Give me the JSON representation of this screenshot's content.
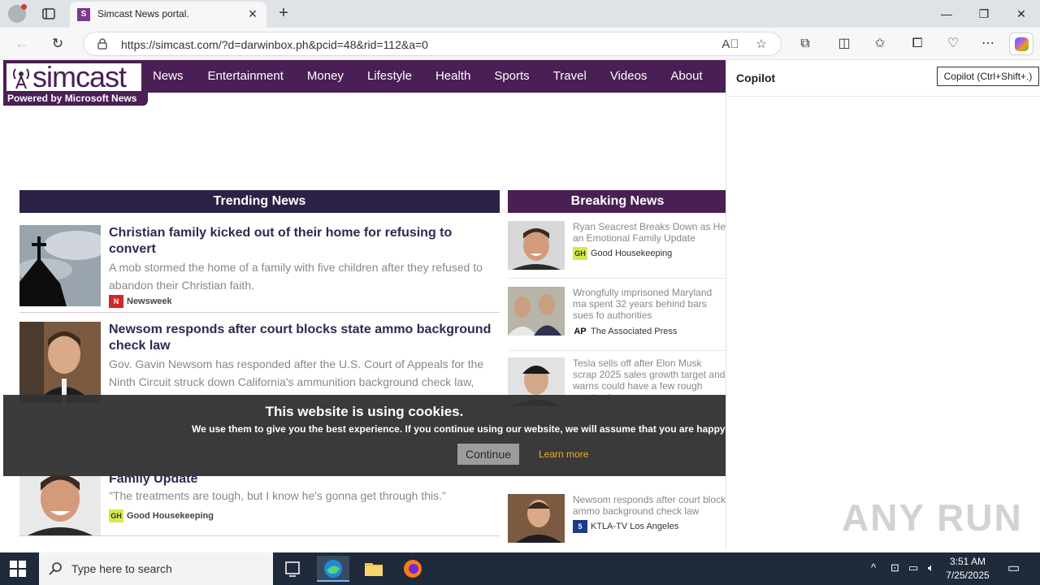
{
  "browser": {
    "tab_title": "Simcast News portal.",
    "url": "https://simcast.com/?d=darwinbox.ph&pcid=48&rid=112&a=0",
    "tooltip": "Copilot (Ctrl+Shift+.)"
  },
  "site": {
    "logo_text": "simcast",
    "logo_sub": "Powered by Microsoft News",
    "nav": [
      "News",
      "Entertainment",
      "Money",
      "Lifestyle",
      "Health",
      "Sports",
      "Travel",
      "Videos",
      "About Us"
    ],
    "trending_header": "Trending News",
    "breaking_header": "Breaking News"
  },
  "trending": [
    {
      "title": "Christian family kicked out of their home for refusing to convert",
      "desc": "A mob stormed the home of a family with five children after they refused to abandon their Christian faith.",
      "source": "Newsweek",
      "source_icon": "N"
    },
    {
      "title": "Newsom responds after court blocks state ammo background check law",
      "desc": "Gov. Gavin Newsom has responded after the U.S. Court of Appeals for the Ninth Circuit struck down California's ammunition background check law,",
      "source": "",
      "source_icon": ""
    },
    {
      "title": "Family Update",
      "desc": "\"The treatments are tough, but I know he's gonna get through this.\"",
      "source": "Good Housekeeping",
      "source_icon": "GH"
    }
  ],
  "breaking": [
    {
      "title": "Ryan Seacrest Breaks Down as He an Emotional Family Update",
      "source": "Good Housekeeping",
      "source_icon": "GH"
    },
    {
      "title": "Wrongfully imprisoned Maryland ma spent 32 years behind bars sues fo authorities",
      "source": "The Associated Press",
      "source_icon": "AP"
    },
    {
      "title": "Tesla sells off after Elon Musk scrap 2025 sales growth target and warns could have a few rough quarters'",
      "source": "",
      "source_icon": ""
    },
    {
      "title": "Newsom responds after court block ammo background check law",
      "source": "KTLA-TV Los Angeles",
      "source_icon": "5"
    }
  ],
  "cookie": {
    "title": "This website is using cookies.",
    "text": "We use them to give you the best experience. If you continue using our website, we will assume that you are happy to receiv",
    "continue": "Continue",
    "learn_more": "Learn more"
  },
  "copilot": {
    "title": "Copilot"
  },
  "watermark": "ANY RUN",
  "taskbar": {
    "search_placeholder": "Type here to search",
    "time": "3:51 AM",
    "date": "7/25/2025"
  }
}
